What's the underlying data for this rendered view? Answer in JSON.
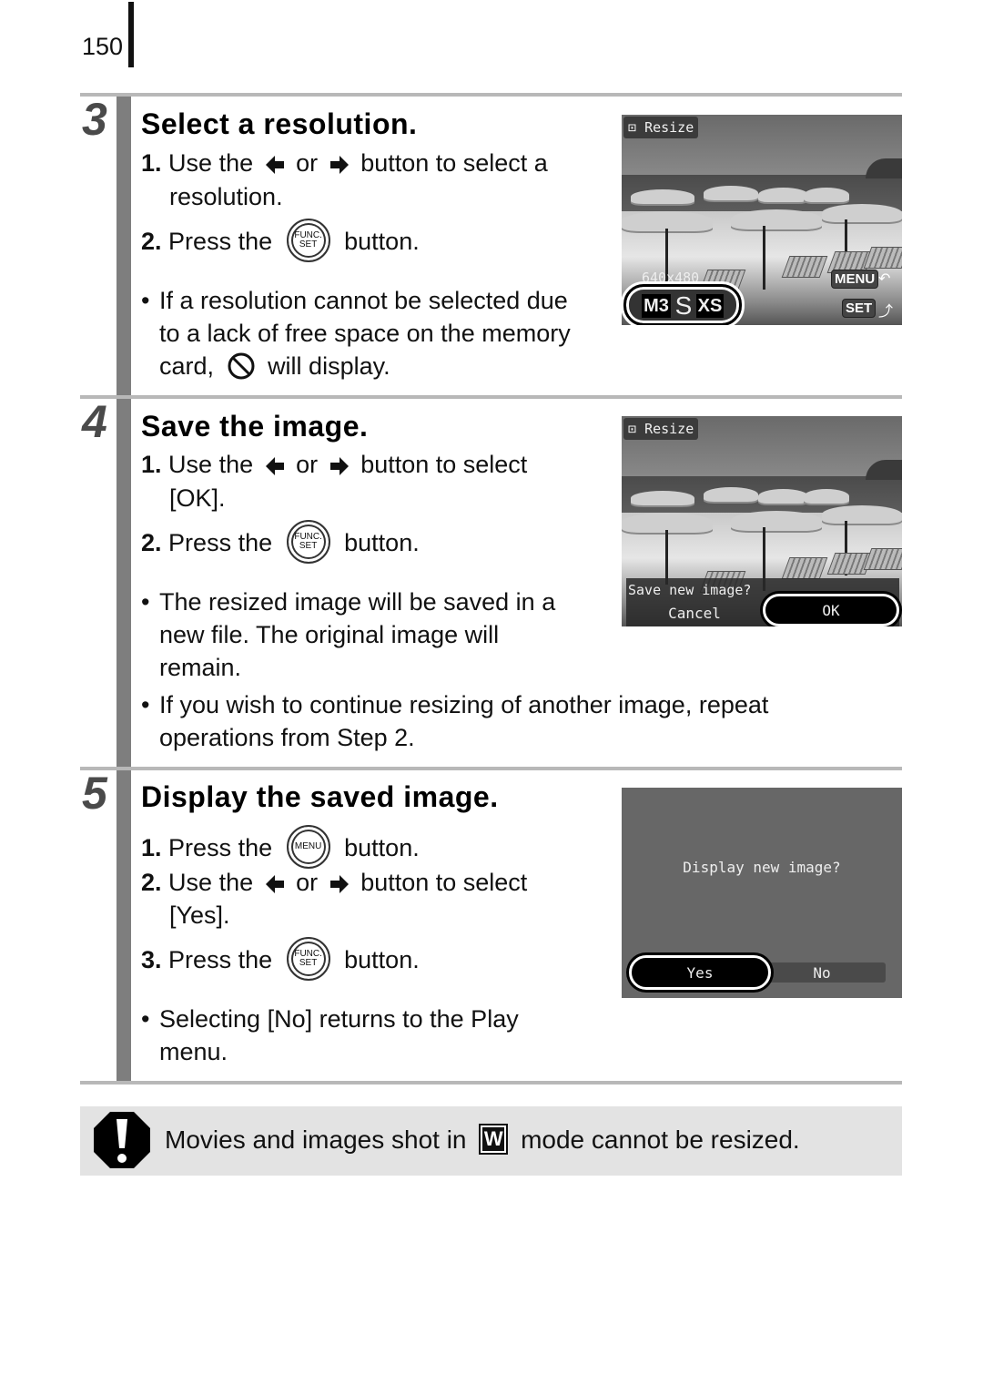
{
  "page": {
    "number": "150"
  },
  "steps": [
    {
      "number": "3",
      "title": "Select a resolution.",
      "instructions": [
        {
          "num": "1.",
          "pre": "Use the",
          "mid": "or",
          "post": "button to select a",
          "cont": "resolution."
        },
        {
          "num": "2.",
          "pre": "Press the",
          "button": "FUNC./SET",
          "post": "button."
        }
      ],
      "notes": [
        {
          "lines": [
            "If a resolution cannot be selected due",
            "to a lack of free space on the memory"
          ],
          "last_pre": "card,",
          "last_post": "will display.",
          "icon": "prohibited-icon"
        }
      ],
      "screen": {
        "menu_title": "Resize",
        "size_readout": "640x480",
        "options": [
          "M3",
          "S",
          "XS"
        ],
        "selected_option": "S",
        "menu_key": "MENU",
        "set_key": "SET"
      }
    },
    {
      "number": "4",
      "title": "Save the image.",
      "instructions": [
        {
          "num": "1.",
          "pre": "Use the",
          "mid": "or",
          "post": "button to select",
          "cont": "[OK]."
        },
        {
          "num": "2.",
          "pre": "Press the",
          "button": "FUNC./SET",
          "post": "button."
        }
      ],
      "notes": [
        {
          "lines": [
            "The resized image will be saved in a",
            "new file. The original image will",
            "remain."
          ]
        },
        {
          "lines": [
            "If you wish to continue resizing of another image, repeat",
            "operations from Step 2."
          ]
        }
      ],
      "screen": {
        "menu_title": "Resize",
        "prompt": "Save new image?",
        "cancel_label": "Cancel",
        "ok_label": "OK",
        "selected": "OK"
      }
    },
    {
      "number": "5",
      "title": "Display the saved image.",
      "instructions": [
        {
          "num": "1.",
          "pre": "Press the",
          "button": "MENU",
          "post": "button."
        },
        {
          "num": "2.",
          "pre": "Use the",
          "mid": "or",
          "post": "button to select",
          "cont": "[Yes]."
        },
        {
          "num": "3.",
          "pre": "Press the",
          "button": "FUNC./SET",
          "post": "button."
        }
      ],
      "notes": [
        {
          "lines": [
            "Selecting [No] returns to the Play",
            "menu."
          ]
        }
      ],
      "screen": {
        "prompt": "Display new image?",
        "yes_label": "Yes",
        "no_label": "No",
        "selected": "Yes"
      }
    }
  ],
  "notice": {
    "pre": "Movies and images shot in",
    "mode_icon_letter": "W",
    "post": "mode cannot be resized."
  },
  "buttons": {
    "func_top": "FUNC.",
    "func_bottom": "SET",
    "menu": "MENU"
  }
}
